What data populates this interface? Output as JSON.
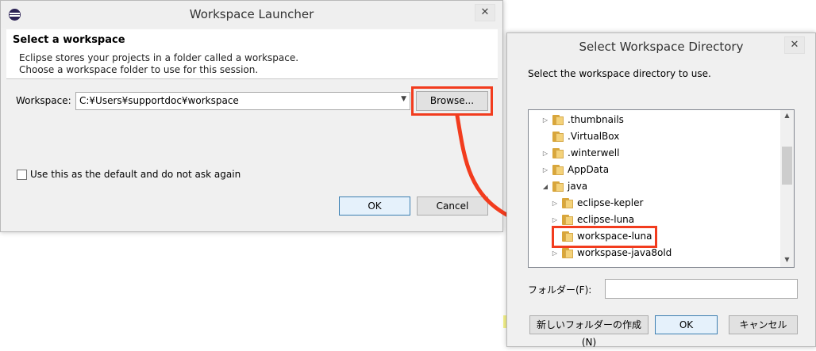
{
  "launcher": {
    "title": "Workspace Launcher",
    "close_glyph": "✕",
    "header_title": "Select a workspace",
    "header_line1": "Eclipse stores your projects in a folder called a workspace.",
    "header_line2": "Choose a workspace folder to use for this session.",
    "workspace_label": "Workspace:",
    "workspace_value": "C:¥Users¥supportdoc¥workspace",
    "browse_label": "Browse...",
    "default_checkbox_label": "Use this as the default and do not ask again",
    "default_checked": false,
    "ok_label": "OK",
    "cancel_label": "Cancel"
  },
  "directory_dialog": {
    "title": "Select Workspace Directory",
    "close_glyph": "✕",
    "instruction": "Select the workspace directory to use.",
    "tree_items": [
      {
        "label": ".thumbnails",
        "depth": 0,
        "expander": "▷"
      },
      {
        "label": ".VirtualBox",
        "depth": 0,
        "expander": ""
      },
      {
        "label": ".winterwell",
        "depth": 0,
        "expander": "▷"
      },
      {
        "label": "AppData",
        "depth": 0,
        "expander": "▷"
      },
      {
        "label": "java",
        "depth": 0,
        "expander": "◢"
      },
      {
        "label": "eclipse-kepler",
        "depth": 1,
        "expander": "▷"
      },
      {
        "label": "eclipse-luna",
        "depth": 1,
        "expander": "▷"
      },
      {
        "label": "workspace-luna",
        "depth": 1,
        "expander": ""
      },
      {
        "label": "workspase-java8old",
        "depth": 1,
        "expander": "▷"
      }
    ],
    "folder_label": "フォルダー(F):",
    "folder_value": "",
    "new_folder_label": "新しいフォルダーの作成(N)",
    "ok_label": "OK",
    "cancel_label": "キャンセル"
  },
  "colors": {
    "highlight": "#f23c1e",
    "folder": "#f4d27a",
    "dialog_bg": "#f0f0f0"
  }
}
